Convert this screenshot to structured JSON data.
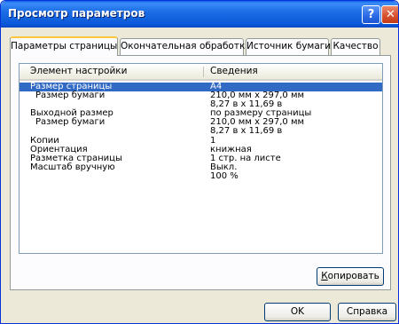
{
  "window": {
    "title": "Просмотр параметров",
    "help_icon_glyph": "?",
    "close_icon_glyph": "✕"
  },
  "tabs": [
    {
      "label": "Параметры страницы",
      "active": true
    },
    {
      "label": "Окончательная обработка",
      "active": false
    },
    {
      "label": "Источник бумаги",
      "active": false
    },
    {
      "label": "Качество",
      "active": false
    }
  ],
  "list": {
    "columns": [
      "Элемент настройки",
      "Сведения"
    ],
    "rows": [
      {
        "item": "Размер страницы",
        "value": "A4",
        "selected": true
      },
      {
        "item": "Размер бумаги",
        "value": "210,0 мм x 297,0 мм"
      },
      {
        "item": "",
        "value": "8,27 в x 11,69 в"
      },
      {
        "item": "Выходной размер",
        "value": "по размеру страницы"
      },
      {
        "item": "Размер бумаги",
        "value": "210,0 мм x 297,0 мм"
      },
      {
        "item": "",
        "value": "8,27 в x 11,69 в"
      },
      {
        "item": "Копии",
        "value": "1"
      },
      {
        "item": "Ориентация",
        "value": "книжная"
      },
      {
        "item": "Разметка страницы",
        "value": "1 стр. на листе"
      },
      {
        "item": "Масштаб вручную",
        "value": "Выкл."
      },
      {
        "item": "",
        "value": "100 %"
      }
    ]
  },
  "buttons": {
    "copy_mnemonic": "К",
    "copy_rest": "опировать",
    "ok": "OK",
    "help": "Справка"
  },
  "colors": {
    "titlebar": "#0a58d8",
    "selection": "#316ac5",
    "dialog_bg": "#ece9d8",
    "active_tab_accent": "#ffc83c"
  }
}
